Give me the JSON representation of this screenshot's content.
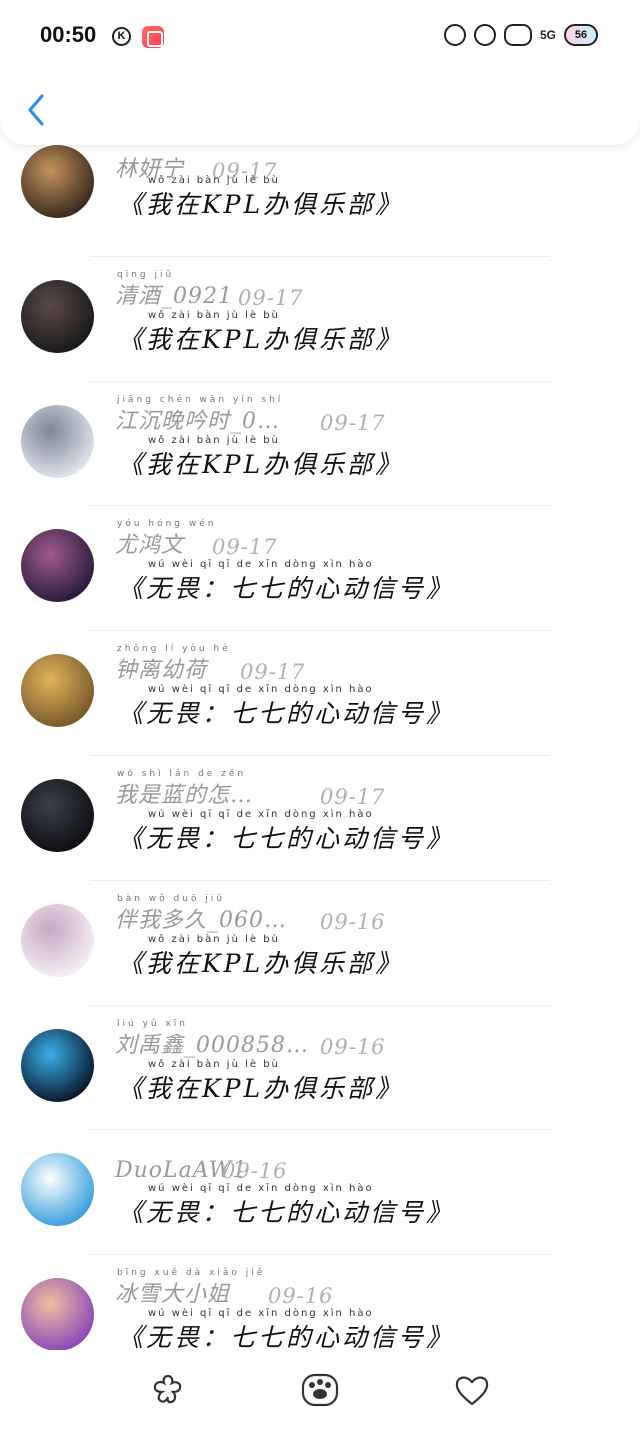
{
  "status_bar": {
    "time": "00:50",
    "k_badge": "K",
    "network": "5G",
    "battery": "56"
  },
  "colors": {
    "back_arrow": "#2b8ef0",
    "name_text": "#9a9a9a",
    "date_text": "#b0b0b0",
    "title_text": "#111111"
  },
  "rows": [
    {
      "name": "林妍宁",
      "name_pinyin": "",
      "date": "09-17",
      "title": "《我在KPL办俱乐部》",
      "title_pinyin": "wǒ  zài        bàn  jù   lè   bù",
      "avatar_colors": [
        "#3b2a1e",
        "#c4935d"
      ]
    },
    {
      "name": "清酒_0921",
      "name_pinyin": "qīng jiǔ",
      "date": "09-17",
      "title": "《我在KPL办俱乐部》",
      "title_pinyin": "wǒ  zài        bàn  jù   lè   bù",
      "avatar_colors": [
        "#1a1a1a",
        "#5a4a48"
      ]
    },
    {
      "name": "江沉晚吟时_0…",
      "name_pinyin": "jiāng chén wǎn yín shí",
      "date": "09-17",
      "title": "《我在KPL办俱乐部》",
      "title_pinyin": "wǒ  zài        bàn  jù   lè   bù",
      "avatar_colors": [
        "#dfe3ea",
        "#7d8696"
      ]
    },
    {
      "name": "尤鸿文",
      "name_pinyin": "yóu hóng wén",
      "date": "09-17",
      "title": "《无畏：七七的心动信号》",
      "title_pinyin": "wú wèi    qī  qī  de xīn dòng xìn hào",
      "avatar_colors": [
        "#2a1c3a",
        "#a05a8c"
      ]
    },
    {
      "name": "钟离幼荷",
      "name_pinyin": "zhōng lí yòu hé",
      "date": "09-17",
      "title": "《无畏：七七的心动信号》",
      "title_pinyin": "wú wèi    qī  qī  de xīn dòng xìn hào",
      "avatar_colors": [
        "#7a5a2a",
        "#e0b45c"
      ]
    },
    {
      "name": "我是蓝的怎…",
      "name_pinyin": "wǒ shì lán de zěn",
      "date": "09-17",
      "title": "《无畏：七七的心动信号》",
      "title_pinyin": "wú wèi    qī  qī  de xīn dòng xìn hào",
      "avatar_colors": [
        "#0f0f12",
        "#3a3f4a"
      ]
    },
    {
      "name": "伴我多久_060…",
      "name_pinyin": "bàn wǒ duō jiǔ",
      "date": "09-16",
      "title": "《我在KPL办俱乐部》",
      "title_pinyin": "wǒ  zài        bàn  jù   lè   bù",
      "avatar_colors": [
        "#f4eef2",
        "#c8a8c4"
      ]
    },
    {
      "name": "刘禹鑫_000858…",
      "name_pinyin": "liú yǔ xīn",
      "date": "09-16",
      "title": "《我在KPL办俱乐部》",
      "title_pinyin": "wǒ  zài        bàn  jù   lè   bù",
      "avatar_colors": [
        "#0b1830",
        "#3ab0e8"
      ]
    },
    {
      "name": "DuoLaAW1",
      "name_pinyin": "",
      "date": "09-16",
      "title": "《无畏：七七的心动信号》",
      "title_pinyin": "wú wèi    qī  qī  de xīn dòng xìn hào",
      "avatar_colors": [
        "#3aa0dc",
        "#ffffff"
      ]
    },
    {
      "name": "冰雪大小姐",
      "name_pinyin": "bīng xuě dà xiǎo jiě",
      "date": "09-16",
      "title": "《无畏：七七的心动信号》",
      "title_pinyin": "wú wèi    qī  qī  de xīn dòng xìn hào",
      "avatar_colors": [
        "#8a4ab8",
        "#f0c0a0"
      ]
    }
  ],
  "tabbar": {
    "icons": [
      "flower-icon",
      "paw-icon",
      "heart-icon"
    ]
  }
}
